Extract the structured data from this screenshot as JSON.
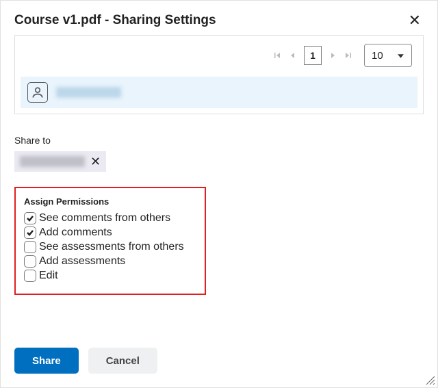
{
  "dialog": {
    "title": "Course v1.pdf - Sharing Settings"
  },
  "pager": {
    "current_page": "1",
    "page_size": "10"
  },
  "share_to": {
    "label": "Share to"
  },
  "permissions": {
    "title": "Assign Permissions",
    "items": [
      {
        "label": "See comments from others",
        "checked": true
      },
      {
        "label": "Add comments",
        "checked": true
      },
      {
        "label": "See assessments from others",
        "checked": false
      },
      {
        "label": "Add assessments",
        "checked": false
      },
      {
        "label": "Edit",
        "checked": false
      }
    ]
  },
  "buttons": {
    "share": "Share",
    "cancel": "Cancel"
  }
}
